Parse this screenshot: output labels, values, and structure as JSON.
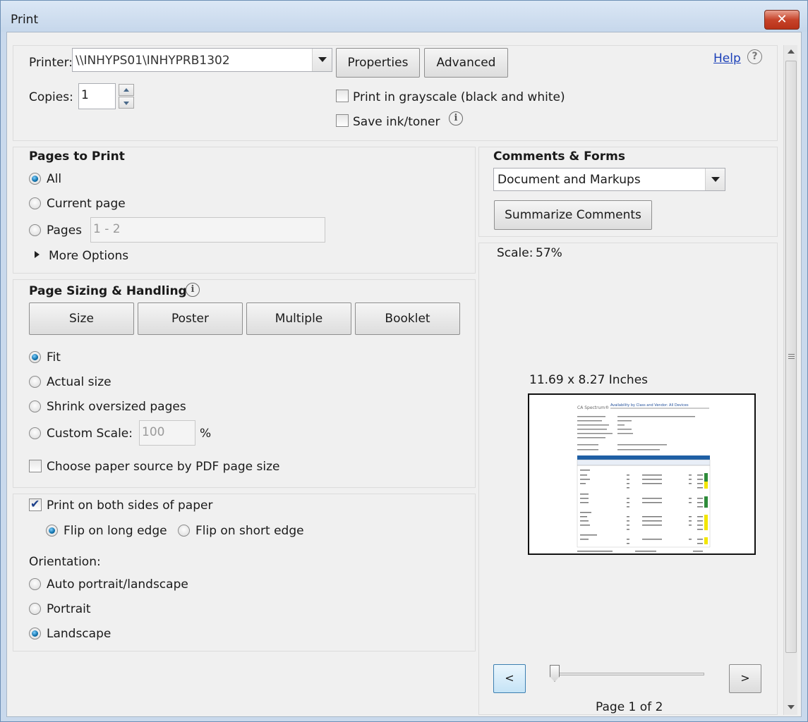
{
  "window": {
    "title": "Print",
    "close_label": "✕"
  },
  "printer": {
    "label": "Printer:",
    "value": "\\\\INHYPS01\\INHYPRB1302",
    "properties_label": "Properties",
    "advanced_label": "Advanced",
    "help_label": "Help",
    "help_icon": "?",
    "copies_label": "Copies:",
    "copies_value": "1",
    "grayscale_label": "Print in grayscale (black and white)",
    "grayscale_checked": false,
    "save_ink_label": "Save ink/toner",
    "save_ink_checked": false,
    "info_icon": "i"
  },
  "pages_to_print": {
    "heading": "Pages to Print",
    "options": [
      "All",
      "Current page",
      "Pages"
    ],
    "selected": "All",
    "pages_value": "1 - 2",
    "more_options_label": "More Options"
  },
  "page_sizing": {
    "heading": "Page Sizing & Handling",
    "info_icon": "i",
    "tabs": [
      "Size",
      "Poster",
      "Multiple",
      "Booklet"
    ],
    "options": [
      "Fit",
      "Actual size",
      "Shrink oversized pages",
      "Custom Scale:"
    ],
    "selected": "Fit",
    "custom_scale_value": "100",
    "custom_scale_unit": "%",
    "paper_source_label": "Choose paper source by PDF page size",
    "paper_source_checked": false
  },
  "duplex": {
    "both_sides_label": "Print on both sides of paper",
    "both_sides_checked": true,
    "flip_long_label": "Flip on long edge",
    "flip_short_label": "Flip on short edge",
    "flip_selected": "long"
  },
  "orientation": {
    "heading": "Orientation:",
    "options": [
      "Auto portrait/landscape",
      "Portrait",
      "Landscape"
    ],
    "selected": "Landscape"
  },
  "comments_forms": {
    "heading": "Comments & Forms",
    "value": "Document and Markups",
    "summarize_label": "Summarize Comments"
  },
  "preview": {
    "scale_label": "Scale:",
    "scale_value": "57%",
    "page_size": "11.69 x 8.27 Inches",
    "prev_label": "<",
    "next_label": ">",
    "page_indicator": "Page 1 of 2",
    "doc": {
      "brand": "CA Spectrum®",
      "title": "Availability by Class and Vendor: All Devices"
    }
  }
}
